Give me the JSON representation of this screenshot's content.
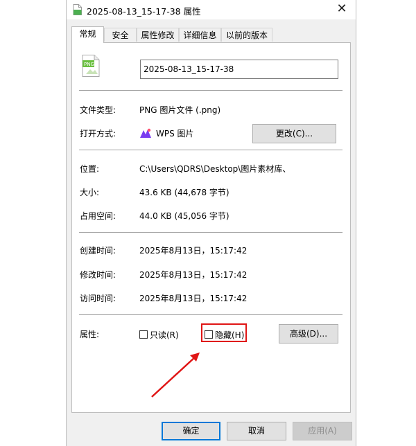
{
  "window": {
    "title": "2025-08-13_15-17-38 属性",
    "close_glyph": "✕"
  },
  "tabs": [
    {
      "label": "常规"
    },
    {
      "label": "安全"
    },
    {
      "label": "属性修改"
    },
    {
      "label": "详细信息"
    },
    {
      "label": "以前的版本"
    }
  ],
  "file": {
    "icon_text": "PNG",
    "name": "2025-08-13_15-17-38"
  },
  "type_row": {
    "label": "文件类型:",
    "value": "PNG 图片文件 (.png)"
  },
  "open_row": {
    "label": "打开方式:",
    "app": "WPS 图片",
    "change_button": "更改(C)..."
  },
  "location_row": {
    "label": "位置:",
    "value": "C:\\Users\\QDRS\\Desktop\\图片素材库、"
  },
  "size_row": {
    "label": "大小:",
    "value": "43.6 KB (44,678 字节)"
  },
  "disk_row": {
    "label": "占用空间:",
    "value": "44.0 KB (45,056 字节)"
  },
  "created_row": {
    "label": "创建时间:",
    "value": "2025年8月13日，15:17:42"
  },
  "modified_row": {
    "label": "修改时间:",
    "value": "2025年8月13日，15:17:42"
  },
  "accessed_row": {
    "label": "访问时间:",
    "value": "2025年8月13日，15:17:42"
  },
  "attributes": {
    "label": "属性:",
    "readonly": "只读(R)",
    "hidden": "隐藏(H)",
    "advanced_button": "高级(D)..."
  },
  "footer": {
    "ok": "确定",
    "cancel": "取消",
    "apply": "应用(A)"
  },
  "colors": {
    "highlight": "#e01515",
    "arrow": "#e01515",
    "primary_border": "#0078d7"
  }
}
